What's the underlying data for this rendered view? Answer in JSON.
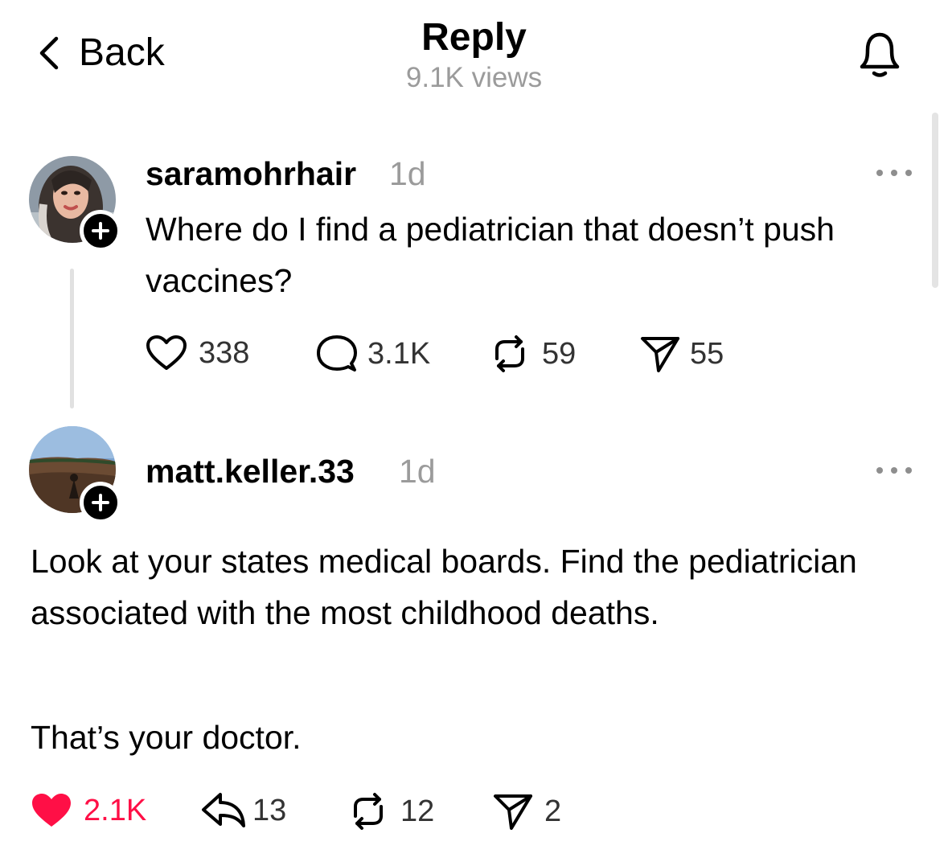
{
  "header": {
    "back_label": "Back",
    "title": "Reply",
    "views": "9.1K views"
  },
  "icons": {
    "back": "chevron-left-icon",
    "notifications": "bell-icon",
    "like": "heart-icon",
    "comment": "comment-bubble-icon",
    "reply": "reply-arrow-icon",
    "repost": "repost-icon",
    "share": "send-icon",
    "more": "more-dots-icon"
  },
  "colors": {
    "liked": "#ff0f46",
    "muted": "#9b9b9b"
  },
  "original_post": {
    "username": "saramohrhair",
    "time": "1d",
    "text": "Where do I find a pediatrician that doesn’t push vaccines?",
    "likes": "338",
    "comments": "3.1K",
    "reposts": "59",
    "shares": "55"
  },
  "reply_post": {
    "username": "matt.keller.33",
    "time": "1d",
    "paragraph_1": "Look at your states medical boards.  Find the pediatrician associated with the most childhood deaths.",
    "paragraph_2": "That’s your doctor.",
    "likes": "2.1K",
    "liked": true,
    "replies": "13",
    "reposts": "12",
    "shares": "2"
  }
}
